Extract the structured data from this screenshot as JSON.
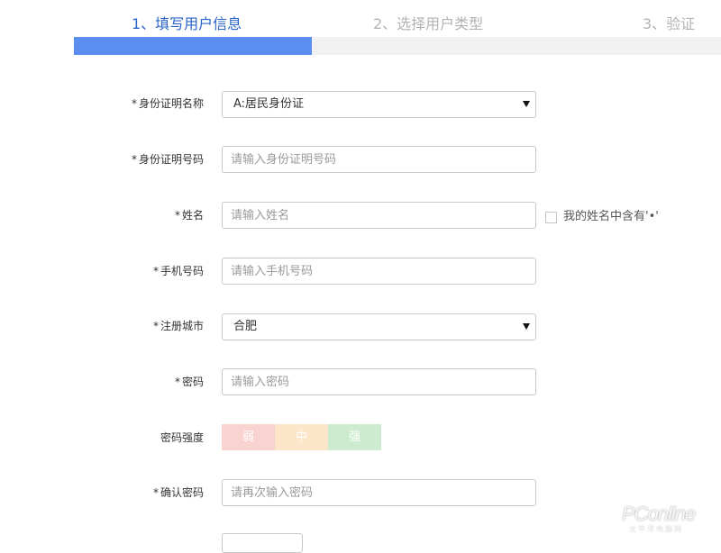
{
  "steps": [
    {
      "label": "1、填写用户信息",
      "state": "active"
    },
    {
      "label": "2、选择用户类型",
      "state": "inactive"
    },
    {
      "label": "3、验证",
      "state": "inactive"
    }
  ],
  "progress": {
    "fraction": 0.367,
    "fill_color": "#5b8ef0",
    "track_color": "#f1f1f1"
  },
  "form": {
    "required_mark": "*",
    "id_type": {
      "label": "身份证明名称",
      "value": "A:居民身份证"
    },
    "id_number": {
      "label": "身份证明号码",
      "placeholder": "请输入身份证明号码"
    },
    "name": {
      "label": "姓名",
      "placeholder": "请输入姓名",
      "checkbox_label": "我的姓名中含有'•'"
    },
    "phone": {
      "label": "手机号码",
      "placeholder": "请输入手机号码"
    },
    "city": {
      "label": "注册城市",
      "value": "合肥"
    },
    "password": {
      "label": "密码",
      "placeholder": "请输入密码"
    },
    "strength": {
      "label": "密码强度",
      "levels": [
        {
          "label": "弱",
          "color": "#f8d3d0"
        },
        {
          "label": "中",
          "color": "#fde5c9"
        },
        {
          "label": "强",
          "color": "#cdeccf"
        }
      ]
    },
    "confirm_password": {
      "label": "确认密码",
      "placeholder": "请再次输入密码"
    }
  },
  "watermark": {
    "text": "PConline",
    "sub": "太平洋电脑网"
  }
}
